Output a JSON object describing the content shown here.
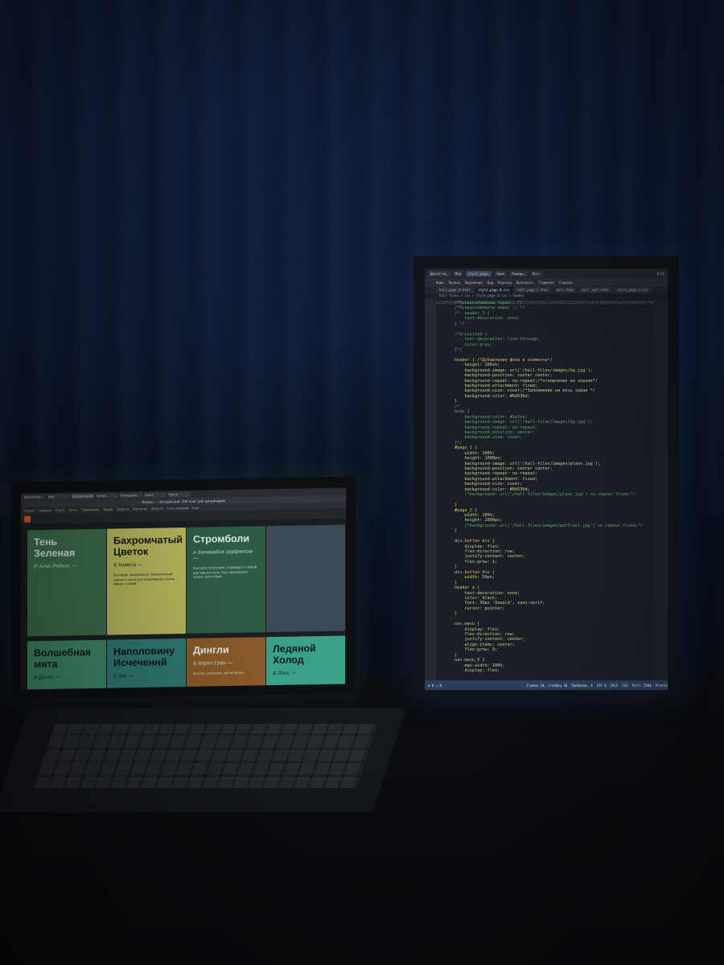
{
  "monitor": {
    "taskbar_items": [
      "Диспетче…",
      "Мой",
      "style_page…",
      "Хром",
      "Помощь…",
      "Пост"
    ],
    "clock": "3:25",
    "menu": [
      "Файл",
      "Правка",
      "Выделение",
      "Вид",
      "Переход",
      "Выполнить",
      "Терминал",
      "Справка"
    ],
    "tabs": [
      "hall_page_0.html",
      "style_page_0.css",
      "hall_page_1.html",
      "hall.html",
      "hall_cart.html",
      "style_page_1.css"
    ],
    "breadcrumb": "hall-files > css > style_page_0.css > header",
    "code_lines": [
      {
        "n": "1",
        "t": "/*Псевдоэлементы через : */",
        "k": "comment"
      },
      {
        "n": "2",
        "t": "/*Псевдоэлементы через :: */",
        "k": "comment"
      },
      {
        "n": "3",
        "t": "/* .header_1 {",
        "k": "comment"
      },
      {
        "n": "4",
        "t": "    text-decoration: none;",
        "k": "comment"
      },
      {
        "n": "5",
        "t": "} */",
        "k": "comment"
      },
      {
        "n": "6",
        "t": "",
        "k": "plain"
      },
      {
        "n": "7",
        "t": "/*a:visited {",
        "k": "comment"
      },
      {
        "n": "8",
        "t": "    text-decoration: line-through;",
        "k": "comment"
      },
      {
        "n": "9",
        "t": "    color:gray;",
        "k": "comment"
      },
      {
        "n": "10",
        "t": "}*/",
        "k": "comment"
      },
      {
        "n": "11",
        "t": "",
        "k": "plain"
      },
      {
        "n": "12",
        "t": "header { /*Добавление фона в элементы*/",
        "k": "sel"
      },
      {
        "n": "13",
        "t": "    height: 100vh;",
        "k": "prop"
      },
      {
        "n": "14",
        "t": "    background-image: url('/hall-files/images/bg.jpg');",
        "k": "prop"
      },
      {
        "n": "15",
        "t": "    background-position: center center;",
        "k": "prop"
      },
      {
        "n": "16",
        "t": "    background-repeat: no-repeat;/*отключение на экране*/",
        "k": "prop"
      },
      {
        "n": "17",
        "t": "    background-attachment: fixed;",
        "k": "prop"
      },
      {
        "n": "18",
        "t": "    background-size: cover;/*Заполнение на весь экран */",
        "k": "prop"
      },
      {
        "n": "19",
        "t": "    background-color: #0d536d;",
        "k": "prop"
      },
      {
        "n": "20",
        "t": "}",
        "k": "sel"
      },
      {
        "n": "21",
        "t": "/*",
        "k": "comment"
      },
      {
        "n": "22",
        "t": "body {",
        "k": "comment"
      },
      {
        "n": "23",
        "t": "    background-color: #5e5ee;",
        "k": "comment"
      },
      {
        "n": "24",
        "t": "    background-image: url('/hall-files/images/bg.jpg');",
        "k": "comment"
      },
      {
        "n": "25",
        "t": "    background-repeat: no-repeat;",
        "k": "comment"
      },
      {
        "n": "26",
        "t": "    background-position: center;",
        "k": "comment"
      },
      {
        "n": "27",
        "t": "    background-size: cover;",
        "k": "comment"
      },
      {
        "n": "28",
        "t": "}*/",
        "k": "comment"
      },
      {
        "n": "29",
        "t": "#page_1 {",
        "k": "sel"
      },
      {
        "n": "30",
        "t": "    width: 100%;",
        "k": "prop"
      },
      {
        "n": "31",
        "t": "    height: 1000px;",
        "k": "prop"
      },
      {
        "n": "32",
        "t": "    background-image: url('/hall-files/images/plans.jpg');",
        "k": "prop"
      },
      {
        "n": "33",
        "t": "    background-position: center center;",
        "k": "prop"
      },
      {
        "n": "34",
        "t": "    background-repeat: no-repeat;",
        "k": "prop"
      },
      {
        "n": "35",
        "t": "    background-attachment: fixed;",
        "k": "prop"
      },
      {
        "n": "36",
        "t": "    background-size: cover;",
        "k": "prop"
      },
      {
        "n": "37",
        "t": "    background-color: #0d536d;",
        "k": "prop"
      },
      {
        "n": "38",
        "t": "    /*background: url('/hall-files/images/plans.jpg') no-repeat fixed;*/",
        "k": "comment"
      },
      {
        "n": "39",
        "t": "",
        "k": "plain"
      },
      {
        "n": "40",
        "t": "}",
        "k": "sel"
      },
      {
        "n": "41",
        "t": "#page_2 {",
        "k": "sel"
      },
      {
        "n": "42",
        "t": "    width: 100%;",
        "k": "prop"
      },
      {
        "n": "43",
        "t": "    height: 2000px;",
        "k": "prop"
      },
      {
        "n": "44",
        "t": "    /*background: url('/hall-files/images/portrait.jpg') no-repeat fixed;*/",
        "k": "comment"
      },
      {
        "n": "45",
        "t": "}",
        "k": "sel"
      },
      {
        "n": "46",
        "t": "",
        "k": "plain"
      },
      {
        "n": "47",
        "t": "div.button div {",
        "k": "sel"
      },
      {
        "n": "48",
        "t": "    display: flex;",
        "k": "prop"
      },
      {
        "n": "49",
        "t": "    flex-direction: row;",
        "k": "prop"
      },
      {
        "n": "50",
        "t": "    justify-content: center;",
        "k": "prop"
      },
      {
        "n": "51",
        "t": "    flex-grow: 1;",
        "k": "prop"
      },
      {
        "n": "52",
        "t": "}",
        "k": "sel"
      },
      {
        "n": "53",
        "t": "div.button div {",
        "k": "sel"
      },
      {
        "n": "54",
        "t": "    width: 50px;",
        "k": "prop"
      },
      {
        "n": "55",
        "t": "}",
        "k": "sel"
      },
      {
        "n": "56",
        "t": "header a {",
        "k": "sel"
      },
      {
        "n": "57",
        "t": "    text-decoration: none;",
        "k": "prop"
      },
      {
        "n": "58",
        "t": "    color: black;",
        "k": "prop"
      },
      {
        "n": "59",
        "t": "    font: 30px 'Oswald', sans-serif;",
        "k": "prop"
      },
      {
        "n": "60",
        "t": "    cursor: pointer;",
        "k": "prop"
      },
      {
        "n": "61",
        "t": "}",
        "k": "sel"
      },
      {
        "n": "62",
        "t": "",
        "k": "plain"
      },
      {
        "n": "63",
        "t": "nav.menu {",
        "k": "sel"
      },
      {
        "n": "64",
        "t": "    display: flex;",
        "k": "prop"
      },
      {
        "n": "65",
        "t": "    flex-direction: row;",
        "k": "prop"
      },
      {
        "n": "66",
        "t": "    justify-content: center;",
        "k": "prop"
      },
      {
        "n": "67",
        "t": "    align-items: center;",
        "k": "prop"
      },
      {
        "n": "68",
        "t": "    flex-grow: 0;",
        "k": "prop"
      },
      {
        "n": "69",
        "t": "}",
        "k": "sel"
      },
      {
        "n": "70",
        "t": "nav.menu_0 {",
        "k": "sel"
      },
      {
        "n": "71",
        "t": "    max-width: 100%;",
        "k": "prop"
      },
      {
        "n": "72",
        "t": "    display: flex;",
        "k": "prop"
      },
      {
        "n": "73",
        "t": "",
        "k": "plain"
      }
    ],
    "status_left": "⊗ 0 ⚠ 0",
    "status_right": [
      "Строка 18, столбец 30",
      "Пробелов: 4",
      "UTF-8",
      "CRLF",
      "CSS",
      "Port: 5500",
      "Prettier"
    ]
  },
  "laptop": {
    "browser_tabs": [
      "Диспетчер…",
      "Мой",
      "Бахромчатый…",
      "Хромо…",
      "Помощник…",
      "Поиск",
      "Почта"
    ],
    "page_title": "Яндекс — Интересное: 100 книг для дизайнеров",
    "bookmarks": [
      "Яндекс",
      "Сервисы",
      "Книги",
      "Почта",
      "Переводчик",
      "Видео",
      "Новости",
      "Картинки",
      "Музыка",
      "Стать автором",
      "Еще"
    ],
    "cards": [
      {
        "title": "Тень Зеленая",
        "author": "И Алан Рейнис —",
        "desc": "",
        "bg": "#3e6e4e",
        "light": true
      },
      {
        "title": "Бахромчатый Цветок",
        "author": "& Комета —",
        "desc": "Бытовой, изысканный, бахромчатый цветок в книге для начинающих очень живое к собой.",
        "bg": "#b6b85c",
        "light": false
      },
      {
        "title": "Стромболи",
        "author": "и Занимайся серфингом —",
        "desc": "Быстрое остроумие, страсбург и гибкий для вашего пути, сам творческого проект для собой.",
        "bg": "#2d5c46",
        "light": true
      },
      {
        "title": "",
        "author": "",
        "desc": "",
        "bg": "#3b4a55",
        "light": true
      },
      {
        "title": "Волшебная мята",
        "author": "& Денис —",
        "desc": "",
        "bg": "#3f8a6a",
        "light": false
      },
      {
        "title": "Наполовину Исчеченнй",
        "author": "& Бас —",
        "desc": "",
        "bg": "#2f7a72",
        "light": false
      },
      {
        "title": "Дингли",
        "author": "& Берил Грин —",
        "desc": "Быстро, различно, делая жизнь.",
        "bg": "#8a5a2a",
        "light": true
      },
      {
        "title": "Ледяной Холод",
        "author": "& Лоос —",
        "desc": "",
        "bg": "#3aa188",
        "light": false
      }
    ]
  },
  "colors": {
    "wall": "#0f1d3a",
    "code_comment": "#66a36b",
    "code_text": "#d6a565",
    "status": "#2c3f5f"
  }
}
